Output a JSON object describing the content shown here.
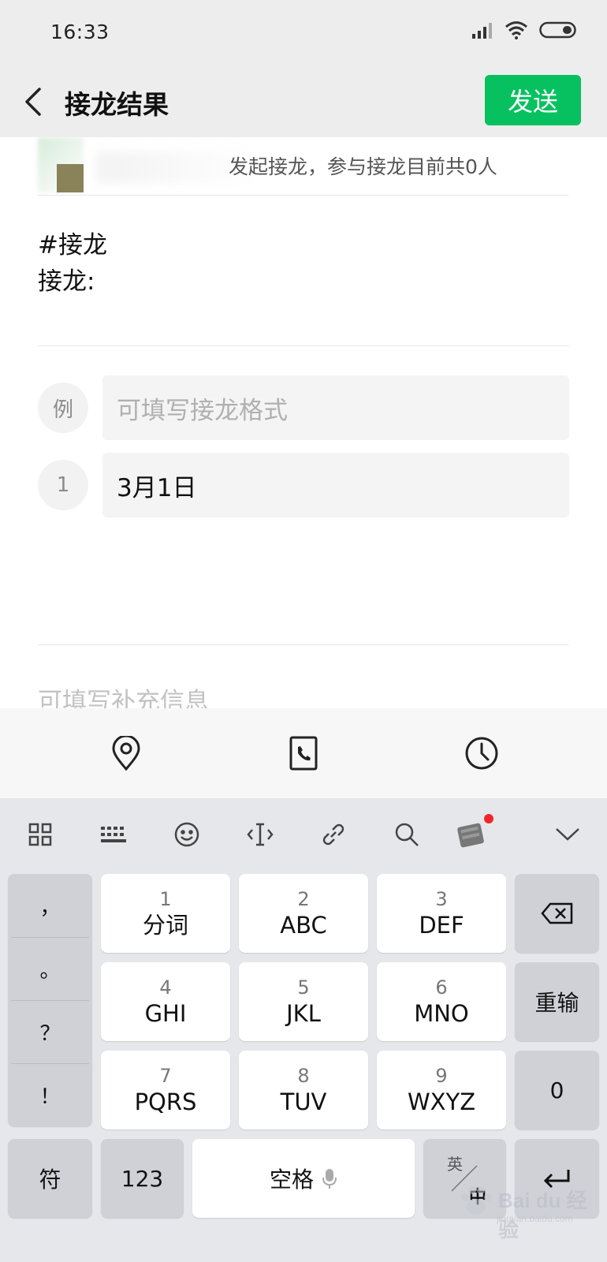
{
  "status_bar": {
    "time": "16:33",
    "icons": [
      "signal-icon",
      "wifi-icon",
      "battery-icon"
    ]
  },
  "header": {
    "title": "接龙结果",
    "send_label": "发送"
  },
  "post": {
    "summary": "发起接龙，参与接龙目前共0人",
    "line1": "#接龙",
    "line2": "接龙:"
  },
  "entries": [
    {
      "index": "例",
      "text": "可填写接龙格式",
      "is_placeholder": true
    },
    {
      "index": "1",
      "text": "3月1日",
      "is_placeholder": false
    }
  ],
  "extra_placeholder": "可填写补充信息",
  "attachments": [
    "location-icon",
    "phone-icon",
    "clock-icon"
  ],
  "keyboard": {
    "toolbar": [
      "grid-icon",
      "keyboard-icon",
      "emoji-icon",
      "cursor-icon",
      "link-icon",
      "search-icon",
      "skin-icon",
      "collapse-icon"
    ],
    "punctuation": [
      "，",
      "。",
      "？",
      "！"
    ],
    "keys": [
      {
        "num": "1",
        "letters": "分词"
      },
      {
        "num": "2",
        "letters": "ABC"
      },
      {
        "num": "3",
        "letters": "DEF"
      },
      {
        "num": "4",
        "letters": "GHI"
      },
      {
        "num": "5",
        "letters": "JKL"
      },
      {
        "num": "6",
        "letters": "MNO"
      },
      {
        "num": "7",
        "letters": "PQRS"
      },
      {
        "num": "8",
        "letters": "TUV"
      },
      {
        "num": "9",
        "letters": "WXYZ"
      }
    ],
    "reinput_label": "重输",
    "zero_label": "0",
    "symbol_label": "符",
    "num_label": "123",
    "space_label": "空格",
    "lang_top": "英",
    "lang_bottom": "中"
  },
  "watermark": {
    "text": "Bai du 经验",
    "sub": "jingyan.baidu.com"
  }
}
